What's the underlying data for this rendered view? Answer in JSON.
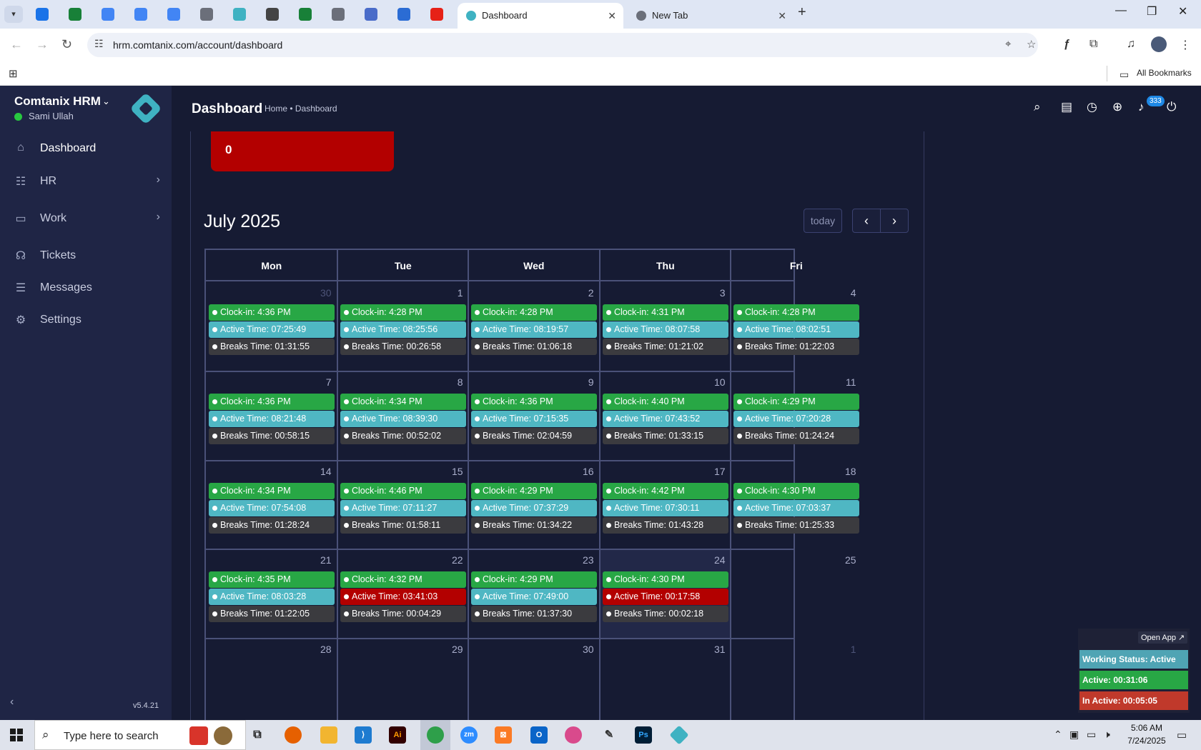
{
  "browser": {
    "tabs": [
      {
        "title": "Dashboard",
        "active": true
      },
      {
        "title": "New Tab",
        "active": false
      }
    ],
    "url": "hrm.comtanix.com/account/dashboard",
    "bookmarks_label": "All Bookmarks",
    "pinned_colors": [
      "#1a73e8",
      "#188038",
      "#4285f4",
      "#4285f4",
      "#4285f4",
      "#6b6f7a",
      "#3fb2c2",
      "#444444",
      "#188038",
      "#6b6f7a",
      "#4a6cc9",
      "#2b6cd4",
      "#e62117"
    ]
  },
  "sidebar": {
    "brand": "Comtanix HRM",
    "user": "Sami Ullah",
    "items": [
      {
        "label": "Dashboard",
        "icon": "home-icon",
        "glyph": "⌂"
      },
      {
        "label": "HR",
        "icon": "users-icon",
        "glyph": "☷"
      },
      {
        "label": "Work",
        "icon": "briefcase-icon",
        "glyph": "▭"
      },
      {
        "label": "Tickets",
        "icon": "headset-icon",
        "glyph": "☊"
      },
      {
        "label": "Messages",
        "icon": "chat-icon",
        "glyph": "☰"
      },
      {
        "label": "Settings",
        "icon": "gear-icon",
        "glyph": "⚙"
      }
    ],
    "version": "v5.4.21"
  },
  "topbar": {
    "title": "Dashboard",
    "breadcrumb": "Home • Dashboard",
    "notification_count": "333"
  },
  "summary_card": {
    "value": "0",
    "color": "#b30000"
  },
  "calendar": {
    "title": "July 2025",
    "today_label": "today",
    "prev_glyph": "‹",
    "next_glyph": "›",
    "weekdays": [
      "Mon",
      "Tue",
      "Wed",
      "Thu",
      "Fri"
    ],
    "weeks": [
      [
        {
          "day": "30",
          "other": true,
          "clock": "Clock-in: 4:36 PM",
          "active": "Active Time: 07:25:49",
          "breaks": "Breaks Time: 01:31:55",
          "alert": false
        },
        {
          "day": "1",
          "clock": "Clock-in: 4:28 PM",
          "active": "Active Time: 08:25:56",
          "breaks": "Breaks Time: 00:26:58",
          "alert": false
        },
        {
          "day": "2",
          "clock": "Clock-in: 4:28 PM",
          "active": "Active Time: 08:19:57",
          "breaks": "Breaks Time: 01:06:18",
          "alert": false
        },
        {
          "day": "3",
          "clock": "Clock-in: 4:31 PM",
          "active": "Active Time: 08:07:58",
          "breaks": "Breaks Time: 01:21:02",
          "alert": false
        },
        {
          "day": "4",
          "clock": "Clock-in: 4:28 PM",
          "active": "Active Time: 08:02:51",
          "breaks": "Breaks Time: 01:22:03",
          "alert": false
        }
      ],
      [
        {
          "day": "7",
          "clock": "Clock-in: 4:36 PM",
          "active": "Active Time: 08:21:48",
          "breaks": "Breaks Time: 00:58:15",
          "alert": false
        },
        {
          "day": "8",
          "clock": "Clock-in: 4:34 PM",
          "active": "Active Time: 08:39:30",
          "breaks": "Breaks Time: 00:52:02",
          "alert": false
        },
        {
          "day": "9",
          "clock": "Clock-in: 4:36 PM",
          "active": "Active Time: 07:15:35",
          "breaks": "Breaks Time: 02:04:59",
          "alert": false
        },
        {
          "day": "10",
          "clock": "Clock-in: 4:40 PM",
          "active": "Active Time: 07:43:52",
          "breaks": "Breaks Time: 01:33:15",
          "alert": false
        },
        {
          "day": "11",
          "clock": "Clock-in: 4:29 PM",
          "active": "Active Time: 07:20:28",
          "breaks": "Breaks Time: 01:24:24",
          "alert": false
        }
      ],
      [
        {
          "day": "14",
          "clock": "Clock-in: 4:34 PM",
          "active": "Active Time: 07:54:08",
          "breaks": "Breaks Time: 01:28:24",
          "alert": false
        },
        {
          "day": "15",
          "clock": "Clock-in: 4:46 PM",
          "active": "Active Time: 07:11:27",
          "breaks": "Breaks Time: 01:58:11",
          "alert": false
        },
        {
          "day": "16",
          "clock": "Clock-in: 4:29 PM",
          "active": "Active Time: 07:37:29",
          "breaks": "Breaks Time: 01:34:22",
          "alert": false
        },
        {
          "day": "17",
          "clock": "Clock-in: 4:42 PM",
          "active": "Active Time: 07:30:11",
          "breaks": "Breaks Time: 01:43:28",
          "alert": false
        },
        {
          "day": "18",
          "clock": "Clock-in: 4:30 PM",
          "active": "Active Time: 07:03:37",
          "breaks": "Breaks Time: 01:25:33",
          "alert": false
        }
      ],
      [
        {
          "day": "21",
          "clock": "Clock-in: 4:35 PM",
          "active": "Active Time: 08:03:28",
          "breaks": "Breaks Time: 01:22:05",
          "alert": false
        },
        {
          "day": "22",
          "clock": "Clock-in: 4:32 PM",
          "active": "Active Time: 03:41:03",
          "breaks": "Breaks Time: 00:04:29",
          "alert": true
        },
        {
          "day": "23",
          "clock": "Clock-in: 4:29 PM",
          "active": "Active Time: 07:49:00",
          "breaks": "Breaks Time: 01:37:30",
          "alert": false
        },
        {
          "day": "24",
          "today": true,
          "clock": "Clock-in: 4:30 PM",
          "active": "Active Time: 00:17:58",
          "breaks": "Breaks Time: 00:02:18",
          "alert": true
        },
        {
          "day": "25"
        }
      ],
      [
        {
          "day": "28"
        },
        {
          "day": "29"
        },
        {
          "day": "30"
        },
        {
          "day": "31"
        },
        {
          "day": "1",
          "other": true
        }
      ]
    ]
  },
  "widget": {
    "open_app": "Open App ↗",
    "working_status": "Working Status: Active",
    "active": "Active: 00:31:06",
    "inactive": "In Active: 00:05:05"
  },
  "taskbar": {
    "search_placeholder": "Type here to search",
    "time": "5:06 AM",
    "date": "7/24/2025"
  }
}
